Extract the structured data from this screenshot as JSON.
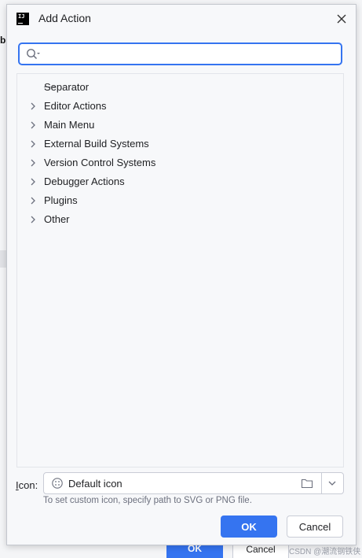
{
  "background": {
    "fragment_text": "b",
    "ok_label": "OK",
    "cancel_label": "Cancel",
    "watermark": "CSDN @潮流钢铁侠"
  },
  "dialog": {
    "title": "Add Action",
    "app_icon_text": "IJ",
    "search": {
      "value": "",
      "placeholder": ""
    },
    "tree": [
      {
        "label": "Separator",
        "type": "separator"
      },
      {
        "label": "Editor Actions",
        "type": "group"
      },
      {
        "label": "Main Menu",
        "type": "group"
      },
      {
        "label": "External Build Systems",
        "type": "group"
      },
      {
        "label": "Version Control Systems",
        "type": "group"
      },
      {
        "label": "Debugger Actions",
        "type": "group"
      },
      {
        "label": "Plugins",
        "type": "group"
      },
      {
        "label": "Other",
        "type": "group"
      }
    ],
    "icon_field": {
      "label_mnemonic": "I",
      "label_rest": "con:",
      "value": "Default icon",
      "hint": "To set custom icon, specify path to SVG or PNG file."
    },
    "ok_label": "OK",
    "cancel_label": "Cancel"
  },
  "colors": {
    "accent": "#3574f0",
    "text": "#1e1f22",
    "hint": "#6c707e",
    "border": "#c9ccd6"
  },
  "icons": [
    "close-icon",
    "search-icon",
    "chevron-right-icon",
    "folder-icon",
    "chevron-down-icon",
    "default-icon"
  ]
}
